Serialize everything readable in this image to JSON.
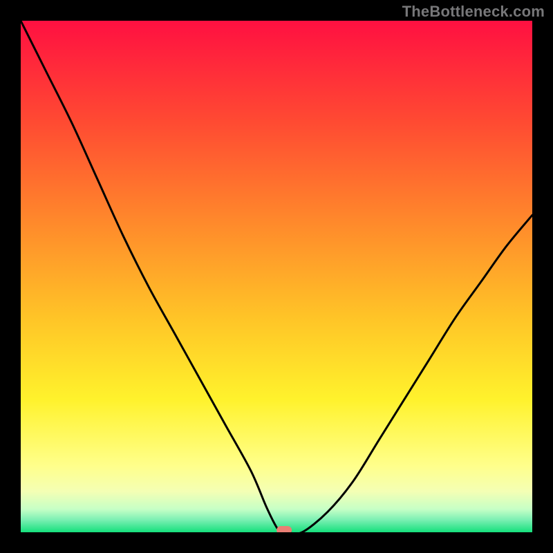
{
  "watermark": "TheBottleneck.com",
  "chart_data": {
    "type": "line",
    "title": "",
    "xlabel": "",
    "ylabel": "",
    "xlim": [
      0,
      100
    ],
    "ylim": [
      0,
      100
    ],
    "x": [
      0,
      5,
      10,
      15,
      20,
      25,
      30,
      35,
      40,
      45,
      48,
      50,
      51,
      52,
      55,
      60,
      65,
      70,
      75,
      80,
      85,
      90,
      95,
      100
    ],
    "values": [
      100,
      90,
      80,
      69,
      58,
      48,
      39,
      30,
      21,
      12,
      5,
      1,
      0,
      0,
      0,
      4,
      10,
      18,
      26,
      34,
      42,
      49,
      56,
      62
    ],
    "background_gradient": {
      "stops": [
        {
          "pos": 0.0,
          "color": "#ff1041"
        },
        {
          "pos": 0.2,
          "color": "#ff4b32"
        },
        {
          "pos": 0.4,
          "color": "#ff8b2b"
        },
        {
          "pos": 0.58,
          "color": "#ffc427"
        },
        {
          "pos": 0.74,
          "color": "#fff22c"
        },
        {
          "pos": 0.87,
          "color": "#ffff8b"
        },
        {
          "pos": 0.92,
          "color": "#f4ffb4"
        },
        {
          "pos": 0.955,
          "color": "#c6ffc6"
        },
        {
          "pos": 0.975,
          "color": "#7ef0b4"
        },
        {
          "pos": 1.0,
          "color": "#15e07c"
        }
      ]
    },
    "marker": {
      "x": 51.5,
      "y": 0,
      "color": "#e97f74"
    }
  }
}
